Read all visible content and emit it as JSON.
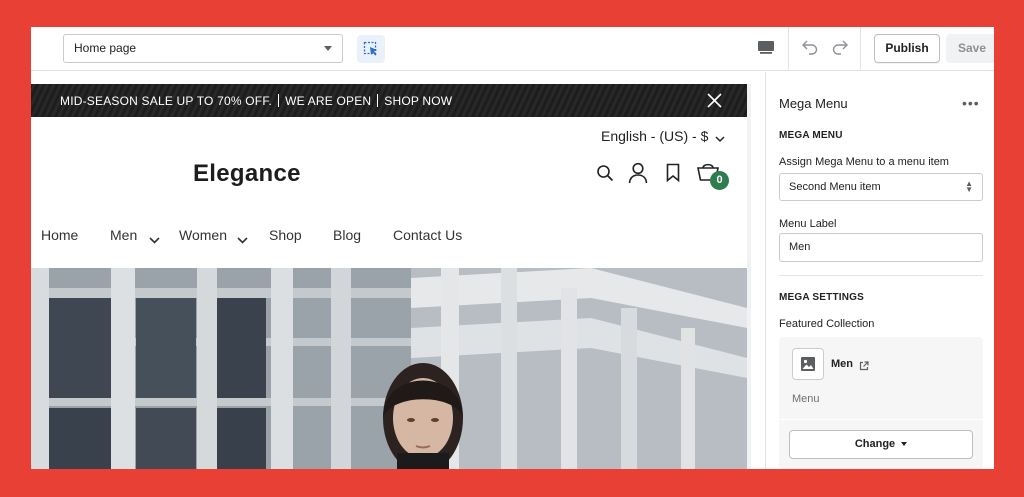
{
  "editor": {
    "page_select_value": "Home page",
    "publish_label": "Publish",
    "save_label": "Save"
  },
  "icons": {
    "inspect": "select-cursor-icon",
    "device": "desktop-icon",
    "undo": "undo-icon",
    "redo": "redo-icon",
    "close": "close-icon",
    "search": "search-icon",
    "account": "user-icon",
    "wishlist": "bookmark-icon",
    "cart": "cart-icon",
    "image": "image-icon",
    "external": "external-link-icon"
  },
  "storefront": {
    "announcement": [
      "MID-SEASON SALE UP TO 70% OFF.",
      "WE ARE OPEN",
      "SHOP NOW"
    ],
    "language_currency": "English - (US) - $",
    "logo": "Elegance",
    "cart_count": "0",
    "nav": [
      {
        "label": "Home",
        "has_dropdown": false
      },
      {
        "label": "Men",
        "has_dropdown": true
      },
      {
        "label": "Women",
        "has_dropdown": true
      },
      {
        "label": "Shop",
        "has_dropdown": false
      },
      {
        "label": "Blog",
        "has_dropdown": false
      },
      {
        "label": "Contact Us",
        "has_dropdown": false
      }
    ]
  },
  "panel": {
    "title": "Mega Menu",
    "more": "•••",
    "mega_menu_heading": "MEGA MENU",
    "assign_label": "Assign Mega Menu to a menu item",
    "assign_value": "Second Menu item",
    "menu_label_label": "Menu Label",
    "menu_label_value": "Men",
    "mega_settings_heading": "MEGA SETTINGS",
    "featured_label": "Featured Collection",
    "collection_name": "Men",
    "collection_sub": "Menu",
    "change_label": "Change"
  },
  "colors": {
    "background": "#e84035",
    "cart_badge": "#2e7d4f",
    "announcement_bar": "#1a1a1a"
  }
}
